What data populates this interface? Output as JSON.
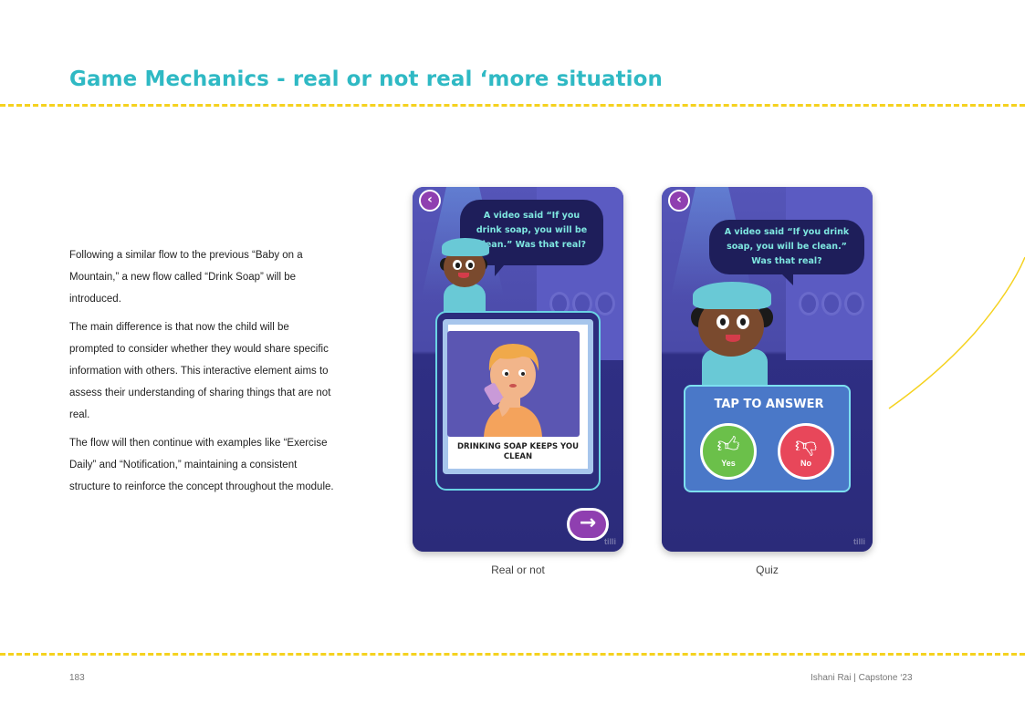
{
  "page": {
    "title": "Game Mechanics - real or not real ‘more situation",
    "page_number": "183",
    "footer_credit": "Ishani Rai | Capstone ‘23"
  },
  "body": {
    "paragraphs": [
      "Following a similar flow to the previous “Baby on a Mountain,” a new flow called “Drink Soap” will be introduced.",
      "The main difference is that now the child will be prompted to consider whether they would share specific information with others. This interactive element aims to assess their understanding of sharing things that are not real.",
      "The flow will then continue with examples like “Exercise Daily” and “Notification,” maintaining a consistent structure to reinforce the concept throughout the module."
    ]
  },
  "screens": {
    "real_or_not": {
      "caption": "Real or not",
      "bubble_text": "A video said “If you drink soap, you will be clean.” Was that real?",
      "card_caption": "DRINKING SOAP KEEPS YOU CLEAN",
      "back_icon": "chevron-left-icon",
      "next_icon": "arrow-right-icon",
      "watermark": "tilli"
    },
    "quiz": {
      "caption": "Quiz",
      "bubble_text": "A video said “If you drink soap, you will be clean.” Was that real?",
      "prompt": "TAP TO ANSWER",
      "yes_label": "Yes",
      "no_label": "No",
      "back_icon": "chevron-left-icon",
      "yes_icon": "thumbs-up-icon",
      "no_icon": "thumbs-down-icon",
      "watermark": "tilli"
    }
  },
  "colors": {
    "title": "#2fb9c4",
    "dash": "#f5d21f",
    "screen_bg": "#3f3f9e",
    "button_purple": "#8f3fb0",
    "yes_green": "#6bc04a",
    "no_red": "#e8475a"
  }
}
